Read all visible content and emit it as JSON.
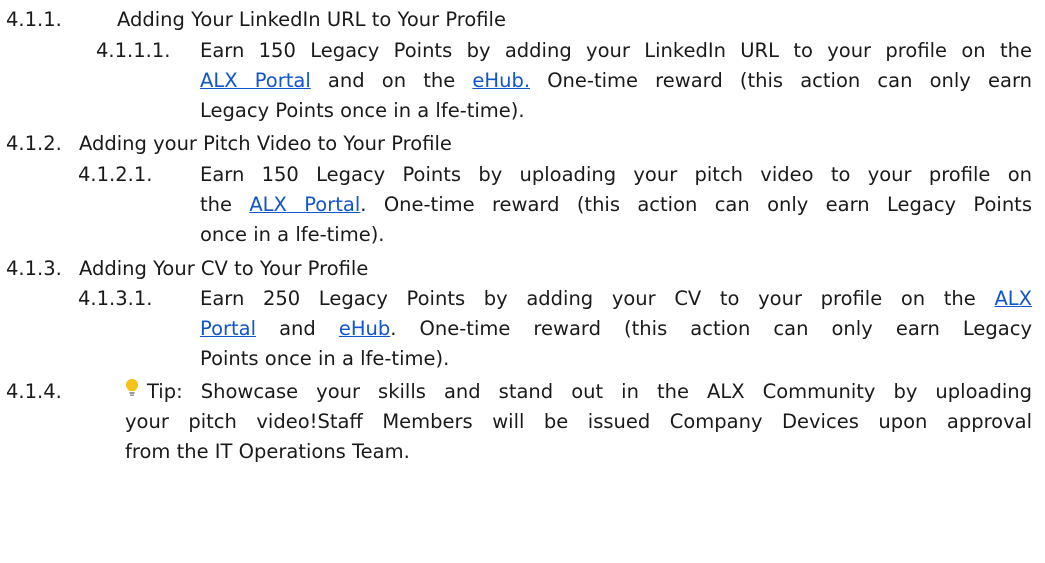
{
  "items": [
    {
      "num": "4.1.1.",
      "heading": "Adding Your LinkedIn URL to Your Profile"
    },
    {
      "num": "4.1.1.1.",
      "line1_a": "Earn 150 Legacy Points by adding your LinkedIn URL to your profile on the",
      "link1": "ALX Portal",
      "line2_mid": " and on the ",
      "link2": "eHub.",
      "line2_end": " One-time reward (this action can only earn",
      "line3": "Legacy Points once in a lfe-time)."
    },
    {
      "num": "4.1.2.",
      "heading": "Adding your Pitch Video to Your Profile"
    },
    {
      "num": "4.1.2.1.",
      "line1_a": "Earn 150 Legacy Points by uploading your pitch video to your profile on",
      "line2_start": "the ",
      "link1": "ALX Portal",
      "line2_end": ". One-time reward  (this action can only earn Legacy Points",
      "line3": "once in a lfe-time)."
    },
    {
      "num": "4.1.3.",
      "heading": "Adding Your CV to Your Profile"
    },
    {
      "num": "4.1.3.1.",
      "line1_a": "Earn 250 Legacy Points by adding your CV to your profile on the ",
      "link1a": "ALX",
      "link1b": "Portal",
      "line2_mid": " and ",
      "link2": "eHub",
      "line2_end": ". One-time reward (this action can only earn Legacy",
      "line3": "Points once in a lfe-time)."
    },
    {
      "num": "4.1.4.",
      "icon": "lightbulb-icon",
      "line1": "Tip: Showcase your skills and stand out in the ALX Community by uploading",
      "line2": "your pitch video!Staff Members will be issued Company Devices upon approval",
      "line3": "from the IT Operations Team."
    }
  ],
  "colors": {
    "link": "#1155cc",
    "text": "#1a1a1a",
    "bulb": "#f0b400"
  }
}
